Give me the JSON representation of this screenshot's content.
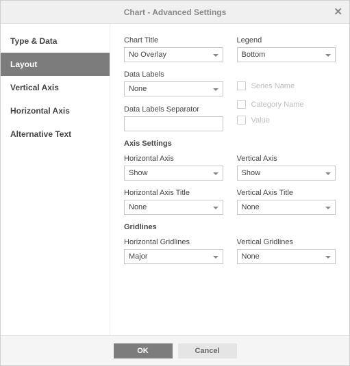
{
  "title": "Chart - Advanced Settings",
  "sidebar": {
    "items": [
      {
        "label": "Type & Data"
      },
      {
        "label": "Layout"
      },
      {
        "label": "Vertical Axis"
      },
      {
        "label": "Horizontal Axis"
      },
      {
        "label": "Alternative Text"
      }
    ]
  },
  "layout": {
    "chart_title_label": "Chart Title",
    "chart_title_value": "No Overlay",
    "legend_label": "Legend",
    "legend_value": "Bottom",
    "data_labels_label": "Data Labels",
    "data_labels_value": "None",
    "data_labels_sep_label": "Data Labels Separator",
    "data_labels_sep_value": "",
    "cb_series_name": "Series Name",
    "cb_category_name": "Category Name",
    "cb_value": "Value",
    "axis_settings_heading": "Axis Settings",
    "h_axis_label": "Horizontal Axis",
    "h_axis_value": "Show",
    "v_axis_label": "Vertical Axis",
    "v_axis_value": "Show",
    "h_axis_title_label": "Horizontal Axis Title",
    "h_axis_title_value": "None",
    "v_axis_title_label": "Vertical Axis Title",
    "v_axis_title_value": "None",
    "gridlines_heading": "Gridlines",
    "h_grid_label": "Horizontal Gridlines",
    "h_grid_value": "Major",
    "v_grid_label": "Vertical Gridlines",
    "v_grid_value": "None"
  },
  "footer": {
    "ok": "OK",
    "cancel": "Cancel"
  }
}
